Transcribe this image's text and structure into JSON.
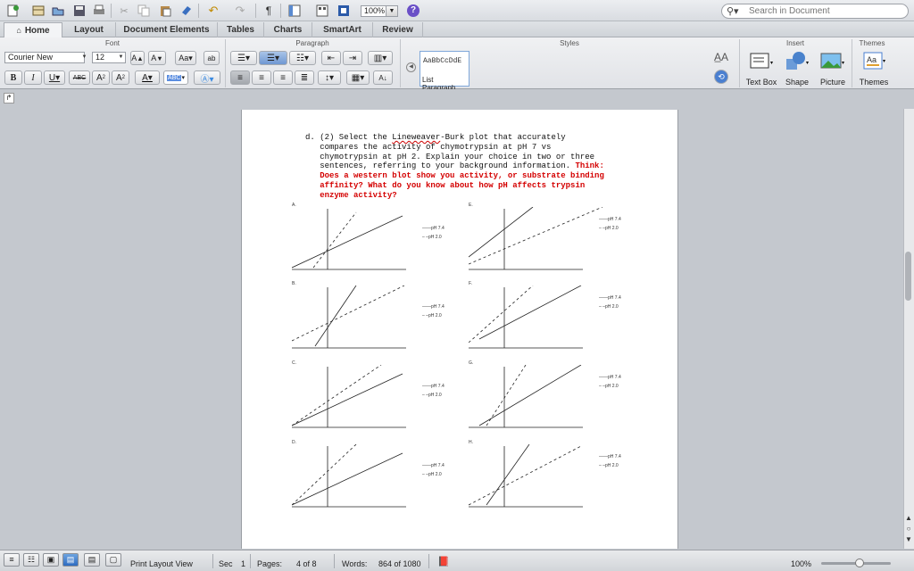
{
  "toolbar": {
    "zoom": "100%",
    "search_placeholder": "Search in Document",
    "icons": [
      "new-icon",
      "templates-icon",
      "open-icon",
      "save-icon",
      "print-icon",
      "cut-icon",
      "copy-icon",
      "paste-icon",
      "format-painter-icon",
      "undo-icon",
      "redo-icon",
      "pilcrow-icon",
      "sidebar-icon",
      "gallery-icon",
      "media-icon",
      "help-icon"
    ]
  },
  "tabs": [
    "Home",
    "Layout",
    "Document Elements",
    "Tables",
    "Charts",
    "SmartArt",
    "Review"
  ],
  "active_tab": "Home",
  "ribbon": {
    "groups": {
      "font": "Font",
      "paragraph": "Paragraph",
      "styles": "Styles",
      "insert": "Insert",
      "themes": "Themes"
    },
    "font_name": "Courier New",
    "font_size": "12",
    "styles_sample": "AaBbCcDdE",
    "style_name": "List Paragraph",
    "insert_items": [
      "Text Box",
      "Shape",
      "Picture"
    ],
    "themes_label": "Themes"
  },
  "document": {
    "question_lines": [
      {
        "parts": [
          {
            "t": "d. (2) Select the "
          },
          {
            "t": "Lineweaver",
            "ul": true
          },
          {
            "t": "-Burk plot that accurately"
          }
        ]
      },
      {
        "parts": [
          {
            "t": "   compares the activity of chymotrypsin at pH 7 vs"
          }
        ]
      },
      {
        "parts": [
          {
            "t": "   chymotrypsin at pH 2. Explain your choice in two or three"
          }
        ]
      },
      {
        "parts": [
          {
            "t": "   sentences, referring to your background information. "
          },
          {
            "t": "Think:",
            "red": true
          }
        ]
      },
      {
        "parts": [
          {
            "t": "   Does a western blot show you activity, or substrate binding",
            "red": true
          }
        ]
      },
      {
        "parts": [
          {
            "t": "   affinity? What do you know about how pH affects trypsin",
            "red": true
          }
        ]
      },
      {
        "parts": [
          {
            "t": "   enzyme activity?",
            "red": true
          }
        ]
      }
    ],
    "legend": {
      "solid": "pH 7.4",
      "dashed": "pH 2.0"
    },
    "plots": [
      {
        "label": "A."
      },
      {
        "label": "E."
      },
      {
        "label": "B."
      },
      {
        "label": "F."
      },
      {
        "label": "C."
      },
      {
        "label": "G."
      },
      {
        "label": "D."
      },
      {
        "label": "H."
      }
    ]
  },
  "status": {
    "view": "Print Layout View",
    "sec_label": "Sec",
    "sec_value": "1",
    "pages_label": "Pages:",
    "pages_value": "4 of 8",
    "words_label": "Words:",
    "words_value": "864 of 1080",
    "zoom": "100%"
  }
}
